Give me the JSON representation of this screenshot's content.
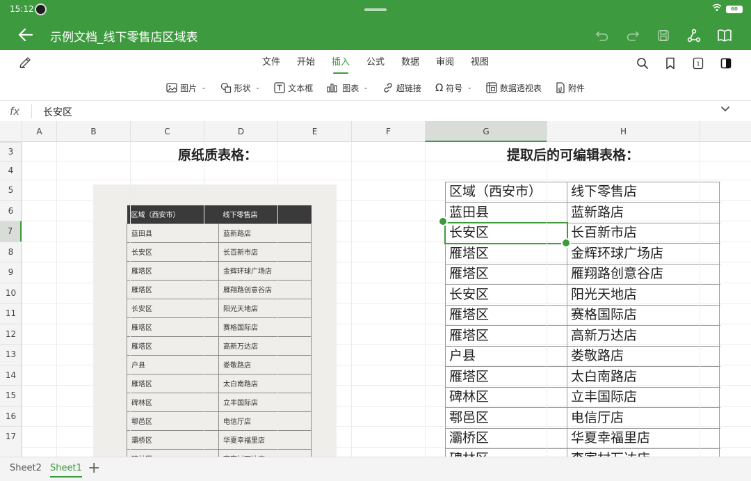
{
  "status": {
    "time": "15:12",
    "battery": "60"
  },
  "title": "示例文档_线下零售店区域表",
  "menu": {
    "tabs": [
      "文件",
      "开始",
      "插入",
      "公式",
      "数据",
      "审阅",
      "视图"
    ],
    "active": 2
  },
  "toolbar": [
    {
      "label": "图片",
      "icon": "image-icon",
      "dropdown": true
    },
    {
      "label": "形状",
      "icon": "shape-icon",
      "dropdown": true
    },
    {
      "label": "文本框",
      "icon": "textbox-icon",
      "dropdown": false
    },
    {
      "label": "图表",
      "icon": "chart-icon",
      "dropdown": true
    },
    {
      "label": "超链接",
      "icon": "link-icon",
      "dropdown": false
    },
    {
      "label": "符号",
      "icon": "omega-icon",
      "dropdown": true
    },
    {
      "label": "数据透视表",
      "icon": "pivot-icon",
      "dropdown": false
    },
    {
      "label": "附件",
      "icon": "attachment-icon",
      "dropdown": false
    }
  ],
  "formula": {
    "fx": "fx",
    "value": "长安区"
  },
  "columns": [
    "A",
    "B",
    "C",
    "D",
    "E",
    "F",
    "G",
    "H"
  ],
  "selected_column": "G",
  "rows": [
    "3",
    "4",
    "5",
    "6",
    "7",
    "8",
    "9",
    "10",
    "11",
    "12",
    "13",
    "14",
    "15",
    "16",
    "17"
  ],
  "selected_row": "7",
  "headings": {
    "left": "原纸质表格：",
    "right": "提取后的可编辑表格："
  },
  "paper_table": {
    "header": [
      "区域（西安市）",
      "线下零售店"
    ],
    "rows": [
      [
        "蓝田县",
        "蓝新路店"
      ],
      [
        "长安区",
        "长百新市店"
      ],
      [
        "雁塔区",
        "金辉环球广场店"
      ],
      [
        "雁塔区",
        "雁翔路创意谷店"
      ],
      [
        "长安区",
        "阳光天地店"
      ],
      [
        "雁塔区",
        "赛格国际店"
      ],
      [
        "雁塔区",
        "高新万达店"
      ],
      [
        "户县",
        "娄敬路店"
      ],
      [
        "雁塔区",
        "太白南路店"
      ],
      [
        "碑林区",
        "立丰国际店"
      ],
      [
        "鄠邑区",
        "电信厅店"
      ],
      [
        "灞桥区",
        "华夏幸福里店"
      ],
      [
        "碑林区",
        "李家村万达店"
      ]
    ]
  },
  "edit_table": {
    "rows": [
      [
        "区域（西安市）",
        "线下零售店"
      ],
      [
        "蓝田县",
        "蓝新路店"
      ],
      [
        "长安区",
        "长百新市店"
      ],
      [
        "雁塔区",
        "金辉环球广场店"
      ],
      [
        "雁塔区",
        "雁翔路创意谷店"
      ],
      [
        "长安区",
        "阳光天地店"
      ],
      [
        "雁塔区",
        "赛格国际店"
      ],
      [
        "雁塔区",
        "高新万达店"
      ],
      [
        "户县",
        "娄敬路店"
      ],
      [
        "雁塔区",
        "太白南路店"
      ],
      [
        "碑林区",
        "立丰国际店"
      ],
      [
        "鄠邑区",
        "电信厅店"
      ],
      [
        "灞桥区",
        "华夏幸福里店"
      ],
      [
        "碑林区",
        "李家村万达店"
      ]
    ]
  },
  "sheets": {
    "tabs": [
      "Sheet2",
      "Sheet1"
    ],
    "active": 1
  },
  "colors": {
    "accent": "#3e9a3f"
  }
}
